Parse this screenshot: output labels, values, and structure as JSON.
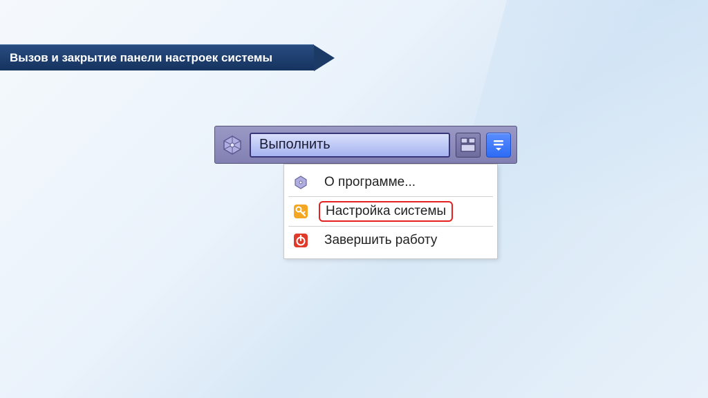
{
  "title_banner": "Вызов и закрытие панели настроек системы",
  "toolbar": {
    "run_label": "Выполнить"
  },
  "menu": {
    "items": [
      {
        "label": "О программе...",
        "highlighted": false
      },
      {
        "label": "Настройка системы",
        "highlighted": true
      },
      {
        "label": "Завершить работу",
        "highlighted": false
      }
    ]
  }
}
